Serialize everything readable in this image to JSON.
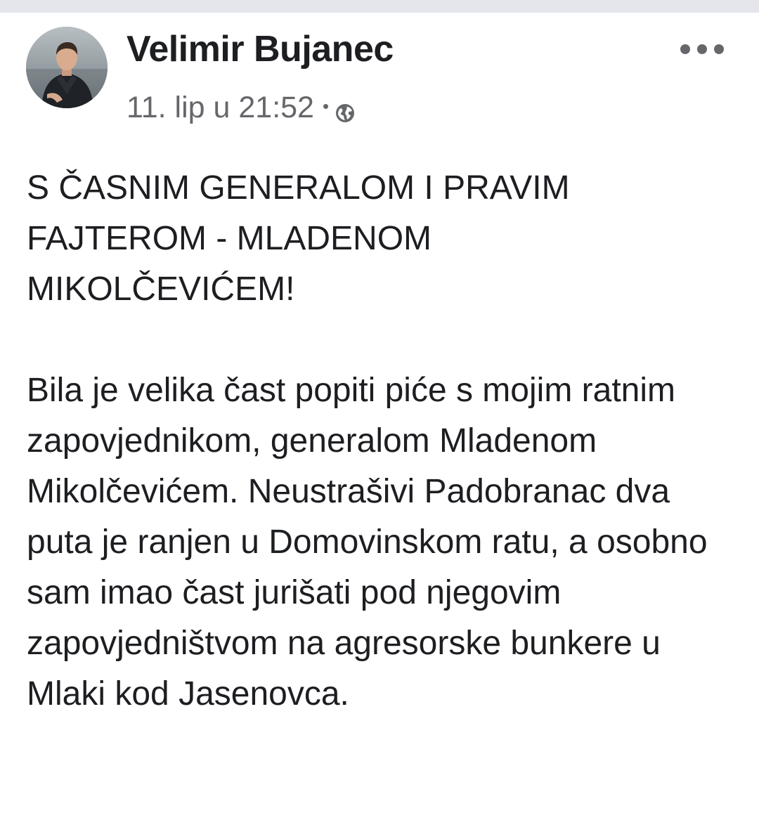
{
  "post": {
    "author_name": "Velimir Bujanec",
    "timestamp": "11. lip u 21:52",
    "separator": "•",
    "audience_icon": "globe-icon",
    "more_icon": "more-options-icon",
    "headline": "S ČASNIM GENERALOM I PRAVIM FAJTEROM - MLADENOM MIKOLČEVIĆEM!",
    "body": "Bila je velika čast popiti piće s mojim ratnim zapovjednikom, generalom Mladenom Mikolčevićem. Neustrašivi Padobranac dva puta je ranjen u Domovinskom ratu, a osobno sam imao čast jurišati pod njegovim zapovjedništvom na agresorske bunkere u Mlaki kod Jasenovca."
  },
  "colors": {
    "text_primary": "#1c1e21",
    "text_secondary": "#65676b",
    "top_strip": "#e4e6eb",
    "background": "#ffffff"
  }
}
